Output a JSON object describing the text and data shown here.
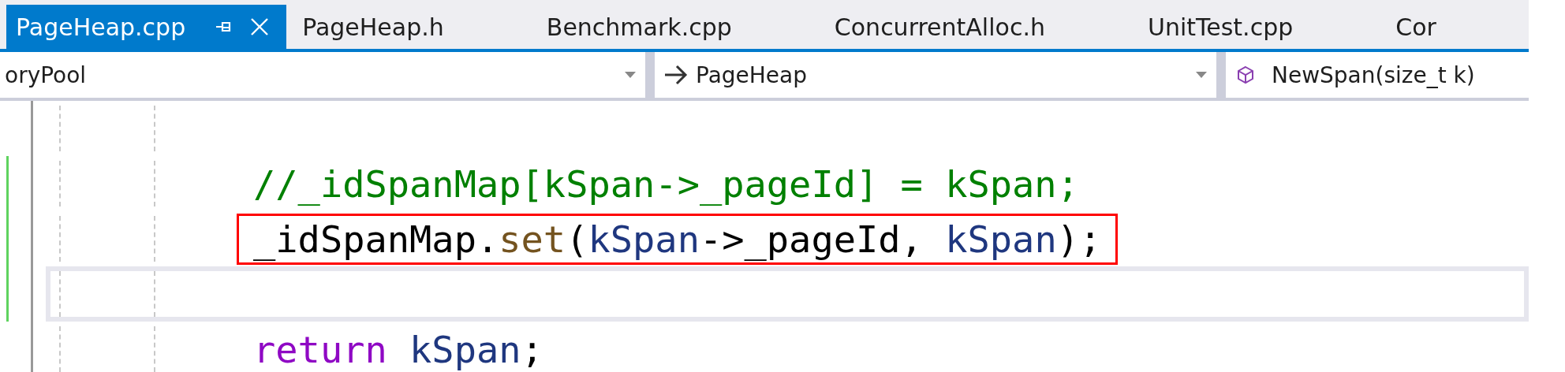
{
  "tabs": [
    {
      "label": "PageHeap.cpp",
      "selected": true
    },
    {
      "label": "PageHeap.h",
      "selected": false
    },
    {
      "label": "Benchmark.cpp",
      "selected": false
    },
    {
      "label": "ConcurrentAlloc.h",
      "selected": false
    },
    {
      "label": "UnitTest.cpp",
      "selected": false
    },
    {
      "label": "Cor",
      "selected": false
    }
  ],
  "navigation_bar": {
    "scope": "oryPool",
    "type": "PageHeap",
    "member": "NewSpan(size_t k)"
  },
  "code_lines": [
    {
      "kind": "blank",
      "changed": false,
      "current": false,
      "boxed": false
    },
    {
      "kind": "code",
      "changed": true,
      "current": false,
      "boxed": false,
      "tokens": [
        {
          "kind": "comment",
          "text": "//_idSpanMap[kSpan->_pageId] = kSpan;"
        }
      ]
    },
    {
      "kind": "code",
      "changed": true,
      "current": false,
      "boxed": true,
      "tokens": [
        {
          "kind": "plain",
          "text": "_idSpanMap."
        },
        {
          "kind": "method",
          "text": "set"
        },
        {
          "kind": "plain",
          "text": "("
        },
        {
          "kind": "variable",
          "text": "kSpan"
        },
        {
          "kind": "plain",
          "text": "->_pageId, "
        },
        {
          "kind": "variable",
          "text": "kSpan"
        },
        {
          "kind": "plain",
          "text": ");"
        }
      ]
    },
    {
      "kind": "blank",
      "changed": true,
      "current": true,
      "boxed": false
    },
    {
      "kind": "code",
      "changed": false,
      "current": false,
      "boxed": false,
      "tokens": [
        {
          "kind": "keyword",
          "text": "return"
        },
        {
          "kind": "variable",
          "text": " kSpan"
        },
        {
          "kind": "plain",
          "text": ";"
        }
      ]
    }
  ]
}
